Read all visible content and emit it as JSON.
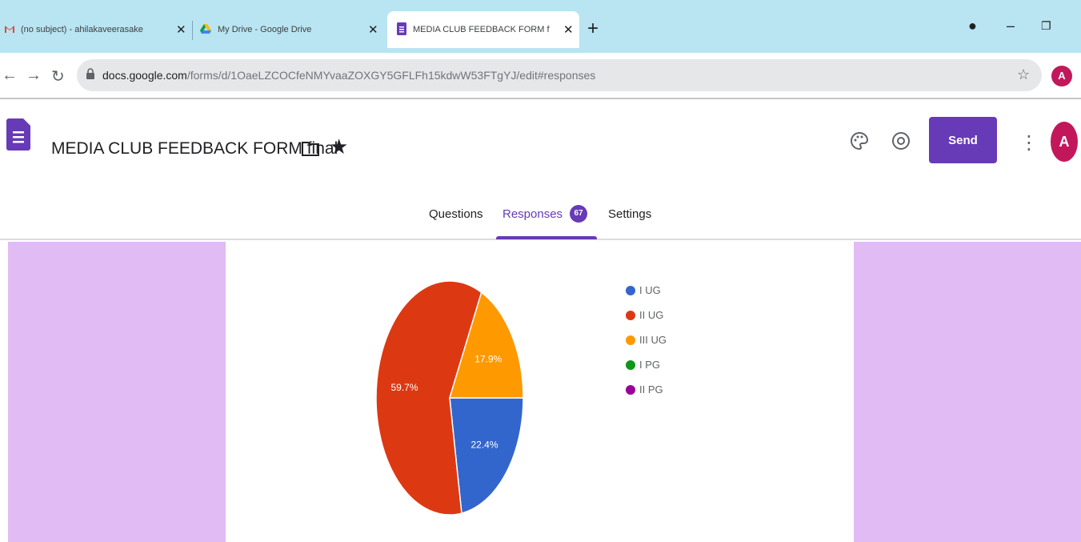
{
  "browser": {
    "tabs": [
      {
        "title": "(no subject) - ahilakaveerasake",
        "icon": "gmail-icon"
      },
      {
        "title": "My Drive - Google Drive",
        "icon": "drive-icon"
      },
      {
        "title": "MEDIA CLUB FEEDBACK FORM f",
        "icon": "forms-icon",
        "active": true
      }
    ],
    "new_tab": "+",
    "url_domain": "docs.google.com",
    "url_path": "/forms/d/1OaeLZCOCfeNMYvaaZOXGY5GFLFh15kdwW53FTgYJ/edit#responses",
    "profile_initial": "A"
  },
  "form": {
    "title": "MEDIA CLUB FEEDBACK FORM final",
    "send_label": "Send",
    "avatar_initial": "A",
    "tabs": {
      "questions": "Questions",
      "responses": "Responses",
      "responses_count": "67",
      "settings": "Settings"
    }
  },
  "colors": {
    "accent": "#673ab7",
    "page_bg": "#e0bbf4",
    "tabstrip": "#b9e4f2"
  },
  "chart_data": {
    "type": "pie",
    "categories": [
      "I UG",
      "II UG",
      "III UG",
      "I PG",
      "II PG"
    ],
    "values": [
      22.4,
      59.7,
      17.9,
      0,
      0
    ],
    "labels": [
      "22.4%",
      "59.7%",
      "17.9%",
      "",
      ""
    ],
    "colors": [
      "#3366cc",
      "#dc3912",
      "#ff9900",
      "#109618",
      "#990099"
    ],
    "legend_position": "right"
  }
}
